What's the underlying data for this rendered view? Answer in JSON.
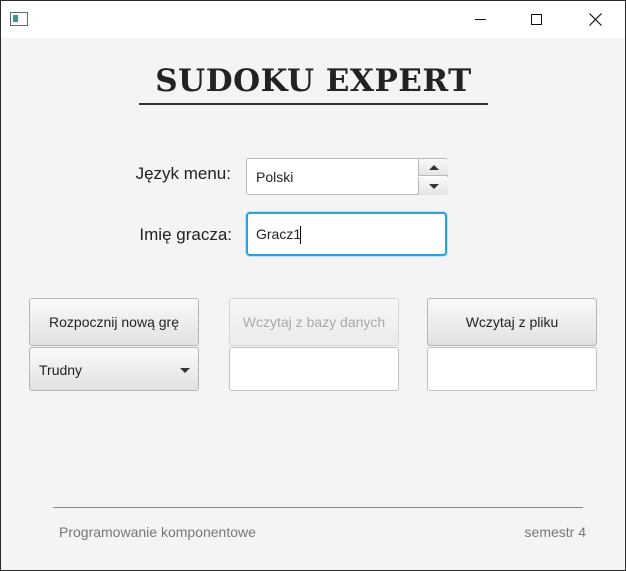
{
  "window": {
    "app_icon": "app-window-icon",
    "controls": {
      "minimize": "minimize-icon",
      "maximize": "maximize-icon",
      "close": "close-icon"
    }
  },
  "header": {
    "title": "SUDOKU EXPERT"
  },
  "form": {
    "language": {
      "label": "Język menu:",
      "value": "Polski"
    },
    "player": {
      "label": "Imię gracza:",
      "value": "Gracz1"
    }
  },
  "actions": {
    "new_game": {
      "label": "Rozpocznij nową grę",
      "difficulty": "Trudny"
    },
    "load_db": {
      "label": "Wczytaj z bazy danych",
      "value": ""
    },
    "load_file": {
      "label": "Wczytaj z pliku",
      "value": ""
    }
  },
  "footer": {
    "left": "Programowanie komponentowe",
    "right": "semestr 4"
  },
  "colors": {
    "focus_accent": "#2ea0dc",
    "disabled_text": "#a8a8a8"
  }
}
